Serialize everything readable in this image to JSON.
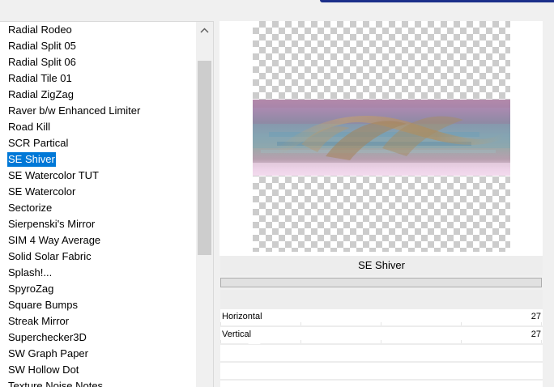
{
  "filter_list": {
    "items": [
      {
        "label": "Radial Rodeo",
        "selected": false
      },
      {
        "label": "Radial Split 05",
        "selected": false
      },
      {
        "label": "Radial Split 06",
        "selected": false
      },
      {
        "label": "Radial Tile 01",
        "selected": false
      },
      {
        "label": "Radial ZigZag",
        "selected": false
      },
      {
        "label": "Raver b/w Enhanced Limiter",
        "selected": false
      },
      {
        "label": "Road Kill",
        "selected": false
      },
      {
        "label": "SCR  Partical",
        "selected": false
      },
      {
        "label": "SE Shiver",
        "selected": true
      },
      {
        "label": "SE Watercolor TUT",
        "selected": false
      },
      {
        "label": "SE Watercolor",
        "selected": false
      },
      {
        "label": "Sectorize",
        "selected": false
      },
      {
        "label": "Sierpenski's Mirror",
        "selected": false
      },
      {
        "label": "SIM 4 Way Average",
        "selected": false
      },
      {
        "label": "Solid Solar Fabric",
        "selected": false
      },
      {
        "label": "Splash!...",
        "selected": false
      },
      {
        "label": "SpyroZag",
        "selected": false
      },
      {
        "label": "Square Bumps",
        "selected": false
      },
      {
        "label": "Streak Mirror",
        "selected": false
      },
      {
        "label": "Superchecker3D",
        "selected": false
      },
      {
        "label": "SW Graph Paper",
        "selected": false
      },
      {
        "label": "SW Hollow Dot",
        "selected": false
      },
      {
        "label": "Texture Noise Notes",
        "selected": false
      }
    ],
    "scroll_up_icon": "chevron-up-icon"
  },
  "preview": {
    "filter_name": "SE Shiver",
    "selection_color": "#0078d7",
    "title_bar_accent": "#1c2f8a"
  },
  "params": [
    {
      "label": "Horizontal",
      "value": "27"
    },
    {
      "label": "Vertical",
      "value": "27"
    }
  ]
}
